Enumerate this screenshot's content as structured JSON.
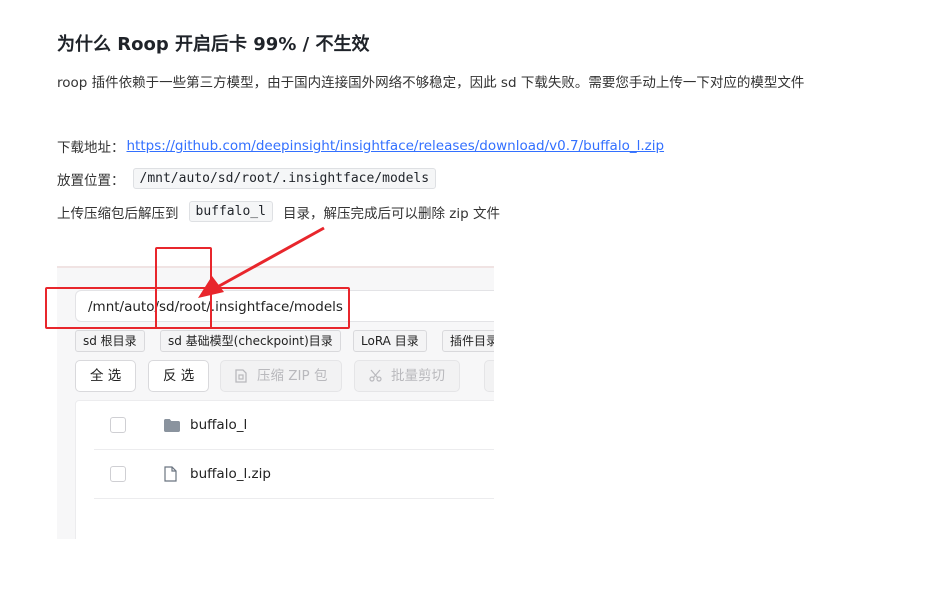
{
  "title": "为什么 Roop 开启后卡 99% / 不生效",
  "intro": "roop 插件依赖于一些第三方模型，由于国内连接国外网络不够稳定，因此 sd 下载失败。需要您手动上传一下对应的模型文件",
  "download": {
    "label": "下载地址：",
    "url": "https://github.com/deepinsight/insightface/releases/download/v0.7/buffalo_l.zip"
  },
  "location": {
    "label": "放置位置：",
    "path": "/mnt/auto/sd/root/.insightface/models"
  },
  "upload": {
    "prefix": "上传压缩包后解压到",
    "dir": "buffalo_l",
    "suffix": "目录，解压完成后可以删除 zip 文件"
  },
  "screenshot": {
    "path_value": "/mnt/auto/sd/root/.insightface/models",
    "quick_dirs": [
      "sd 根目录",
      "sd 基础模型(checkpoint)目录",
      "LoRA 目录",
      "插件目录"
    ],
    "actions": {
      "select_all": "全 选",
      "invert": "反 选",
      "zip": "压缩 ZIP 包",
      "cut": "批量剪切"
    },
    "files": [
      {
        "name": "buffalo_l",
        "icon": "folder-icon"
      },
      {
        "name": "buffalo_l.zip",
        "icon": "file-icon"
      }
    ]
  },
  "colors": {
    "link": "#3370ff",
    "highlight": "#e8262c"
  }
}
